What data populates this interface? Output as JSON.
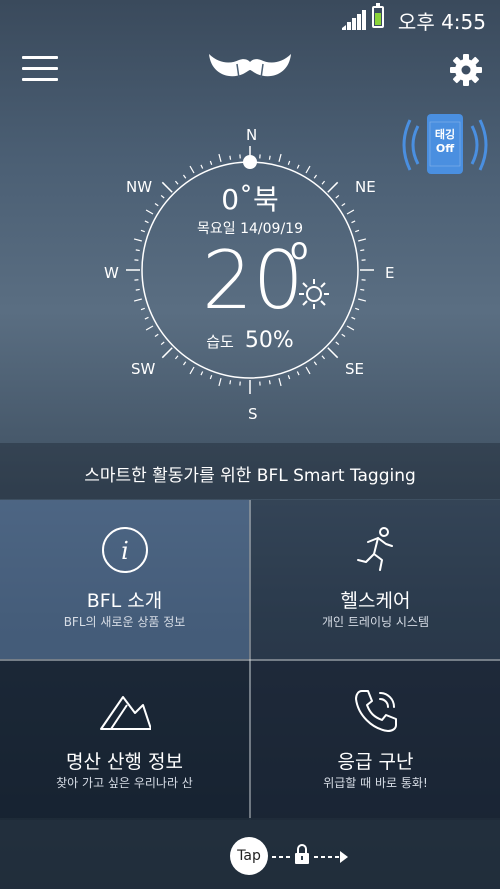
{
  "status": {
    "time": "오후 4:55"
  },
  "tagging": {
    "label_line1": "태깅",
    "label_line2": "Off"
  },
  "compass": {
    "directions": {
      "n": "N",
      "ne": "NE",
      "e": "E",
      "se": "SE",
      "s": "S",
      "sw": "SW",
      "w": "W",
      "nw": "NW"
    },
    "heading": "0˚북",
    "date": "목요일 14/09/19",
    "temperature": "20",
    "temp_unit": "o",
    "humidity_label": "습도",
    "humidity_value": "50%"
  },
  "banner": {
    "text": "스마트한 활동가를 위한 BFL Smart Tagging"
  },
  "menu": [
    {
      "title": "BFL 소개",
      "subtitle": "BFL의 새로운 상품 정보",
      "icon": "info-icon"
    },
    {
      "title": "헬스케어",
      "subtitle": "개인 트레이닝 시스템",
      "icon": "running-person-icon"
    },
    {
      "title": "명산 산행 정보",
      "subtitle": "찾아 가고 싶은 우리나라 산",
      "icon": "mountain-icon"
    },
    {
      "title": "응급 구난",
      "subtitle": "위급할 때 바로 통화!",
      "icon": "phone-call-icon"
    }
  ],
  "bottom": {
    "tap_label": "Tap"
  },
  "colors": {
    "battery": "#8bd43a",
    "tag_phone": "#4a8fe0"
  }
}
